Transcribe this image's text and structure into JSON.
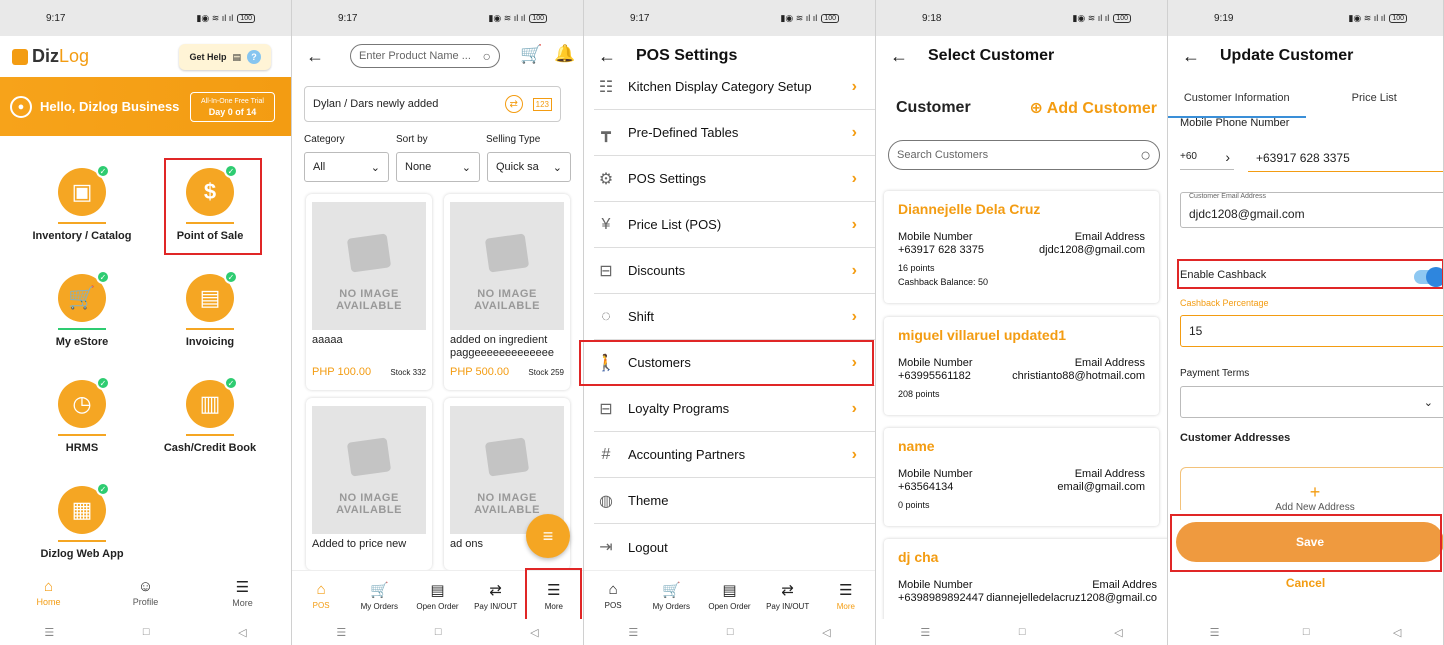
{
  "screen1": {
    "time": "9:17",
    "battery": "100",
    "logo_diz": "Diz",
    "logo_log": "Log",
    "get_help": "Get Help",
    "greeting": "Hello, Dizlog Business",
    "trial_line1": "All-In-One Free Trial",
    "trial_line2": "Day 0 of 14",
    "tiles": [
      "Inventory / Catalog",
      "Point of Sale",
      "My eStore",
      "Invoicing",
      "HRMS",
      "Cash/Credit Book",
      "Dizlog Web App"
    ],
    "nav": [
      "Home",
      "Profile",
      "More"
    ]
  },
  "screen2": {
    "time": "9:17",
    "battery": "100",
    "search_placeholder": "Enter Product Name ...",
    "customer_line": "Dylan / Dars newly added",
    "badge_123": "123",
    "filters": {
      "category_label": "Category",
      "category_value": "All",
      "sort_label": "Sort by",
      "sort_value": "None",
      "type_label": "Selling Type",
      "type_value": "Quick sa"
    },
    "no_image": "NO IMAGE AVAILABLE",
    "products": [
      {
        "name": "aaaaa",
        "price": "PHP 100.00",
        "stock": "Stock 332"
      },
      {
        "name": "added on ingredient paggeeeeeeeeeeeee",
        "price": "PHP 500.00",
        "stock": "Stock 259"
      },
      {
        "name": "Added to price new",
        "price": "",
        "stock": ""
      },
      {
        "name": "ad ons",
        "price": "",
        "stock": ""
      }
    ],
    "nav": [
      "POS",
      "My Orders",
      "Open Order",
      "Pay IN/OUT",
      "More"
    ]
  },
  "screen3": {
    "time": "9:17",
    "battery": "100",
    "title": "POS Settings",
    "items": [
      "Kitchen Display Category Setup",
      "Pre-Defined Tables",
      "POS Settings",
      "Price List (POS)",
      "Discounts",
      "Shift",
      "Customers",
      "Loyalty Programs",
      "Accounting Partners",
      "Theme",
      "Logout"
    ],
    "nav": [
      "POS",
      "My Orders",
      "Open Order",
      "Pay IN/OUT",
      "More"
    ]
  },
  "screen4": {
    "time": "9:18",
    "battery": "100",
    "title": "Select Customer",
    "section": "Customer",
    "add_customer": "Add Customer",
    "search_placeholder": "Search Customers",
    "mobile_label": "Mobile Number",
    "email_label": "Email Address",
    "email_label_cut": "Email Addres",
    "customers": [
      {
        "name": "Diannejelle Dela Cruz",
        "mobile": "+63917 628 3375",
        "email": "djdc1208@gmail.com",
        "points": "16 points",
        "cashback": "Cashback Balance: 50"
      },
      {
        "name": "miguel villaruel updated1",
        "mobile": "+63995561182",
        "email": "christianto88@hotmail.com",
        "points": "208 points",
        "cashback": ""
      },
      {
        "name": "name",
        "mobile": "+63564134",
        "email": "email@gmail.com",
        "points": "0 points",
        "cashback": ""
      },
      {
        "name": "dj cha",
        "mobile": "+6398989892447",
        "email": "diannejelledelacruz1208@gmail.co",
        "points": "",
        "cashback": ""
      }
    ]
  },
  "screen5": {
    "time": "9:19",
    "battery": "100",
    "title": "Update Customer",
    "tab_info": "Customer Information",
    "tab_price": "Price List",
    "mobile_label": "Mobile Phone Number",
    "country_code": "+60",
    "mobile_value": "+63917 628 3375",
    "email_label": "Customer Email Address",
    "email_value": "djdc1208@gmail.com",
    "cashback_toggle_label": "Enable Cashback",
    "cashback_pct_label": "Cashback Percentage",
    "cashback_pct_value": "15",
    "payment_terms_label": "Payment Terms",
    "addresses_label": "Customer Addresses",
    "add_address": "Add New Address",
    "save": "Save",
    "cancel": "Cancel"
  }
}
